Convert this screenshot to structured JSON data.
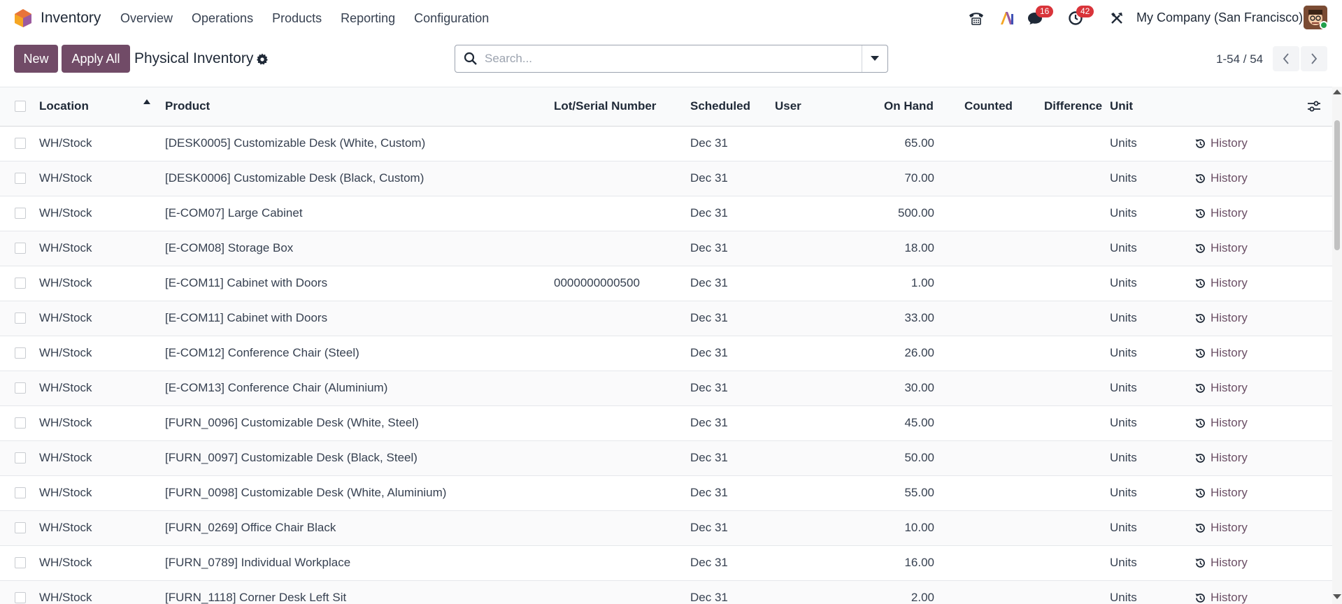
{
  "navbar": {
    "app_name": "Inventory",
    "menu": [
      "Overview",
      "Operations",
      "Products",
      "Reporting",
      "Configuration"
    ],
    "messages_count": "16",
    "activities_count": "42",
    "company": "My Company (San Francisco)"
  },
  "control": {
    "new_label": "New",
    "apply_all_label": "Apply All",
    "title": "Physical Inventory",
    "search_placeholder": "Search...",
    "pager": "1-54 / 54"
  },
  "table": {
    "headers": {
      "location": "Location",
      "product": "Product",
      "lot": "Lot/Serial Number",
      "scheduled": "Scheduled",
      "user": "User",
      "on_hand": "On Hand",
      "counted": "Counted",
      "difference": "Difference",
      "unit": "Unit"
    },
    "history_label": "History",
    "rows": [
      {
        "location": "WH/Stock",
        "product": "[DESK0005] Customizable Desk (White, Custom)",
        "lot": "",
        "scheduled": "Dec 31",
        "on_hand": "65.00",
        "unit": "Units"
      },
      {
        "location": "WH/Stock",
        "product": "[DESK0006] Customizable Desk (Black, Custom)",
        "lot": "",
        "scheduled": "Dec 31",
        "on_hand": "70.00",
        "unit": "Units"
      },
      {
        "location": "WH/Stock",
        "product": "[E-COM07] Large Cabinet",
        "lot": "",
        "scheduled": "Dec 31",
        "on_hand": "500.00",
        "unit": "Units"
      },
      {
        "location": "WH/Stock",
        "product": "[E-COM08] Storage Box",
        "lot": "",
        "scheduled": "Dec 31",
        "on_hand": "18.00",
        "unit": "Units"
      },
      {
        "location": "WH/Stock",
        "product": "[E-COM11] Cabinet with Doors",
        "lot": "0000000000500",
        "scheduled": "Dec 31",
        "on_hand": "1.00",
        "unit": "Units"
      },
      {
        "location": "WH/Stock",
        "product": "[E-COM11] Cabinet with Doors",
        "lot": "",
        "scheduled": "Dec 31",
        "on_hand": "33.00",
        "unit": "Units"
      },
      {
        "location": "WH/Stock",
        "product": "[E-COM12] Conference Chair (Steel)",
        "lot": "",
        "scheduled": "Dec 31",
        "on_hand": "26.00",
        "unit": "Units"
      },
      {
        "location": "WH/Stock",
        "product": "[E-COM13] Conference Chair (Aluminium)",
        "lot": "",
        "scheduled": "Dec 31",
        "on_hand": "30.00",
        "unit": "Units"
      },
      {
        "location": "WH/Stock",
        "product": "[FURN_0096] Customizable Desk (White, Steel)",
        "lot": "",
        "scheduled": "Dec 31",
        "on_hand": "45.00",
        "unit": "Units"
      },
      {
        "location": "WH/Stock",
        "product": "[FURN_0097] Customizable Desk (Black, Steel)",
        "lot": "",
        "scheduled": "Dec 31",
        "on_hand": "50.00",
        "unit": "Units"
      },
      {
        "location": "WH/Stock",
        "product": "[FURN_0098] Customizable Desk (White, Aluminium)",
        "lot": "",
        "scheduled": "Dec 31",
        "on_hand": "55.00",
        "unit": "Units"
      },
      {
        "location": "WH/Stock",
        "product": "[FURN_0269] Office Chair Black",
        "lot": "",
        "scheduled": "Dec 31",
        "on_hand": "10.00",
        "unit": "Units"
      },
      {
        "location": "WH/Stock",
        "product": "[FURN_0789] Individual Workplace",
        "lot": "",
        "scheduled": "Dec 31",
        "on_hand": "16.00",
        "unit": "Units"
      },
      {
        "location": "WH/Stock",
        "product": "[FURN_1118] Corner Desk Left Sit",
        "lot": "",
        "scheduled": "Dec 31",
        "on_hand": "2.00",
        "unit": "Units"
      }
    ]
  },
  "colors": {
    "primary": "#714b67",
    "badge": "#d9343a"
  }
}
